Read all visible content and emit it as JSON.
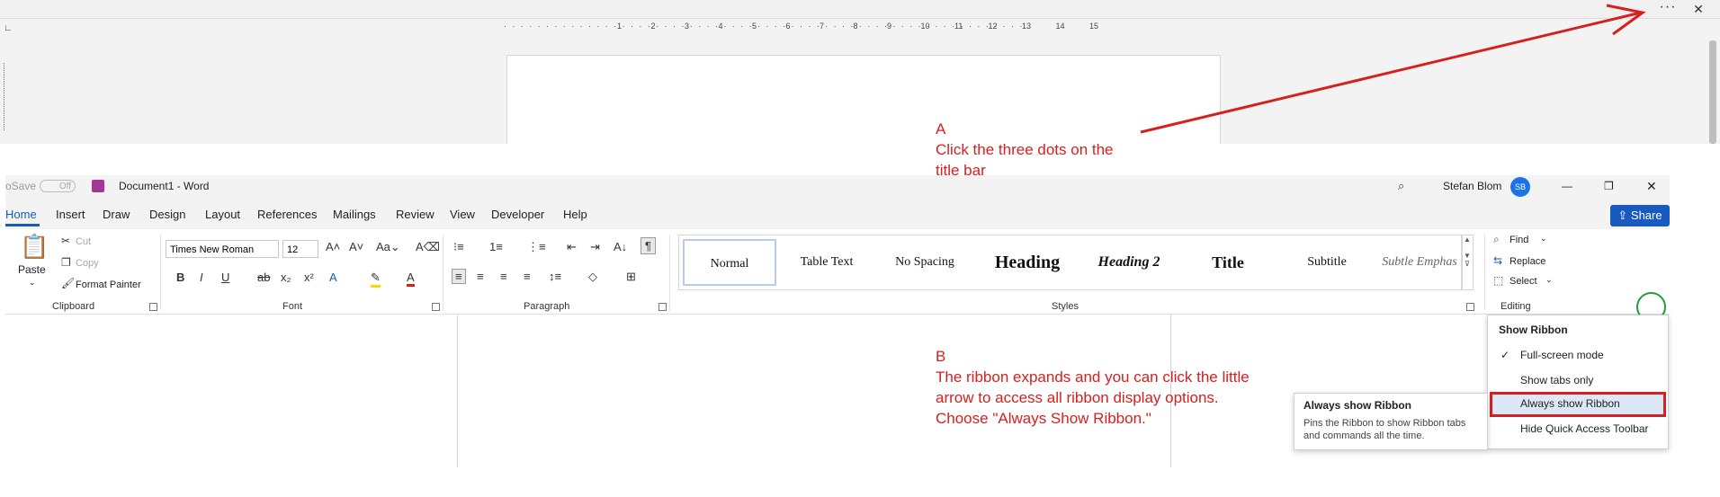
{
  "colors": {
    "accent": "#185abd",
    "annotation": "#d62020",
    "highlight_circle": "#1e9e3a"
  },
  "top": {
    "more_label": "···",
    "close_label": "✕",
    "ruler_numbers": [
      "1",
      "2",
      "3",
      "4",
      "5",
      "6",
      "7",
      "8",
      "9",
      "10",
      "11",
      "12",
      "13",
      "14",
      "15"
    ],
    "annotation_a": {
      "letter": "A",
      "line1": "Click the three dots on the",
      "line2": "title bar"
    }
  },
  "titlebar": {
    "autosave": "oSave",
    "toggle": "Off",
    "doc_title": "Document1  -  Word",
    "user": "Stefan Blom",
    "initials": "SB",
    "min": "—",
    "max": "❐",
    "close": "✕"
  },
  "tabs": [
    "Home",
    "Insert",
    "Draw",
    "Design",
    "Layout",
    "References",
    "Mailings",
    "Review",
    "View",
    "Developer",
    "Help"
  ],
  "share_label": "Share",
  "ribbon": {
    "clipboard": {
      "paste": "Paste",
      "cut": "Cut",
      "copy": "Copy",
      "format_painter": "Format Painter",
      "group": "Clipboard"
    },
    "font": {
      "name": "Times New Roman",
      "size": "12",
      "group": "Font"
    },
    "paragraph": {
      "group": "Paragraph"
    },
    "styles": {
      "items": [
        "Normal",
        "Table Text",
        "No Spacing",
        "Heading",
        "Heading 2",
        "Title",
        "Subtitle",
        "Subtle Emphas"
      ],
      "group": "Styles"
    },
    "editing": {
      "find": "Find",
      "replace": "Replace",
      "select": "Select",
      "group": "Editing"
    }
  },
  "menu": {
    "heading": "Show Ribbon",
    "items": [
      "Full-screen mode",
      "Show tabs only",
      "Always show Ribbon",
      "Hide Quick Access Toolbar"
    ]
  },
  "tooltip": {
    "title": "Always show Ribbon",
    "body": "Pins the Ribbon to show Ribbon tabs and commands all the time."
  },
  "annotation_b": {
    "letter": "B",
    "line1": "The ribbon expands and you can click the little",
    "line2": "arrow to access all ribbon display options.",
    "line3": "Choose \"Always Show Ribbon.\""
  }
}
